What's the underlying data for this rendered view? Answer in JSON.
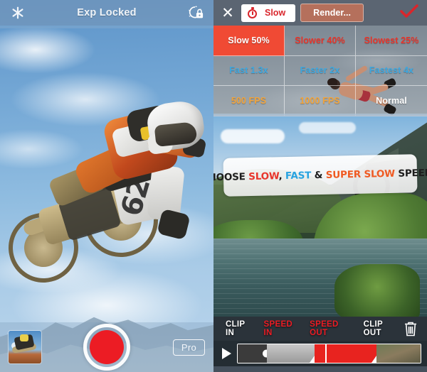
{
  "left_panel": {
    "name": "camera-capture-screen",
    "top_bar": {
      "flash_icon": "starburst-icon",
      "title": "Exp Locked",
      "lock_icon": "camera-exposure-lock-icon"
    },
    "bottom_bar": {
      "gallery_thumbnail": "gallery-thumbnail",
      "record_button": "record-button",
      "pro_label": "Pro"
    }
  },
  "right_panel": {
    "name": "speed-editor-screen",
    "top_bar": {
      "close_label": "✕",
      "mode_icon": "stopwatch-icon",
      "mode_label": "Slow",
      "render_label": "Render...",
      "confirm_icon": "check-icon"
    },
    "speed_grid": {
      "cells": [
        {
          "label": "Slow 50%",
          "color_class": "c-red",
          "selected": true
        },
        {
          "label": "Slower 40%",
          "color_class": "c-red",
          "selected": false
        },
        {
          "label": "Slowest 25%",
          "color_class": "c-red",
          "selected": false
        },
        {
          "label": "Fast 1.3x",
          "color_class": "c-blue",
          "selected": false
        },
        {
          "label": "Faster 2x",
          "color_class": "c-blue",
          "selected": false
        },
        {
          "label": "Fastest 4x",
          "color_class": "c-blue",
          "selected": false
        },
        {
          "label": "500 FPS",
          "color_class": "c-orange",
          "selected": false
        },
        {
          "label": "1000 FPS",
          "color_class": "c-orange",
          "selected": false
        },
        {
          "label": "Normal",
          "color_class": "c-white",
          "selected": false
        }
      ]
    },
    "banner": {
      "word_1": "CHOOSE ",
      "word_slow": "SLOW",
      "word_2": ", ",
      "word_fast": "FAST",
      "word_3": " & ",
      "word_super": "SUPER SLOW",
      "word_4": " SPEEDS"
    },
    "tools": [
      {
        "label": "CLIP IN",
        "style": "white"
      },
      {
        "label": "SPEED IN",
        "style": "red"
      },
      {
        "label": "SPEED OUT",
        "style": "red"
      },
      {
        "label": "CLIP OUT",
        "style": "white"
      }
    ],
    "trash_icon": "trash-icon",
    "scrubber": {
      "play_icon": "play-icon",
      "segments": [
        {
          "kind": "dark",
          "width_pct": 16
        },
        {
          "kind": "gray",
          "width_pct": 26
        },
        {
          "kind": "red",
          "width_pct": 34
        },
        {
          "kind": "photo",
          "width_pct": 24
        }
      ],
      "playhead_pct": 48
    }
  },
  "colors": {
    "accent_red": "#e8352b",
    "selected_cell": "#f04a34",
    "fast_blue": "#3ea8e0",
    "fps_orange": "#f3a43a",
    "render_button": "#b5705c",
    "record_red": "#ec1c24"
  }
}
